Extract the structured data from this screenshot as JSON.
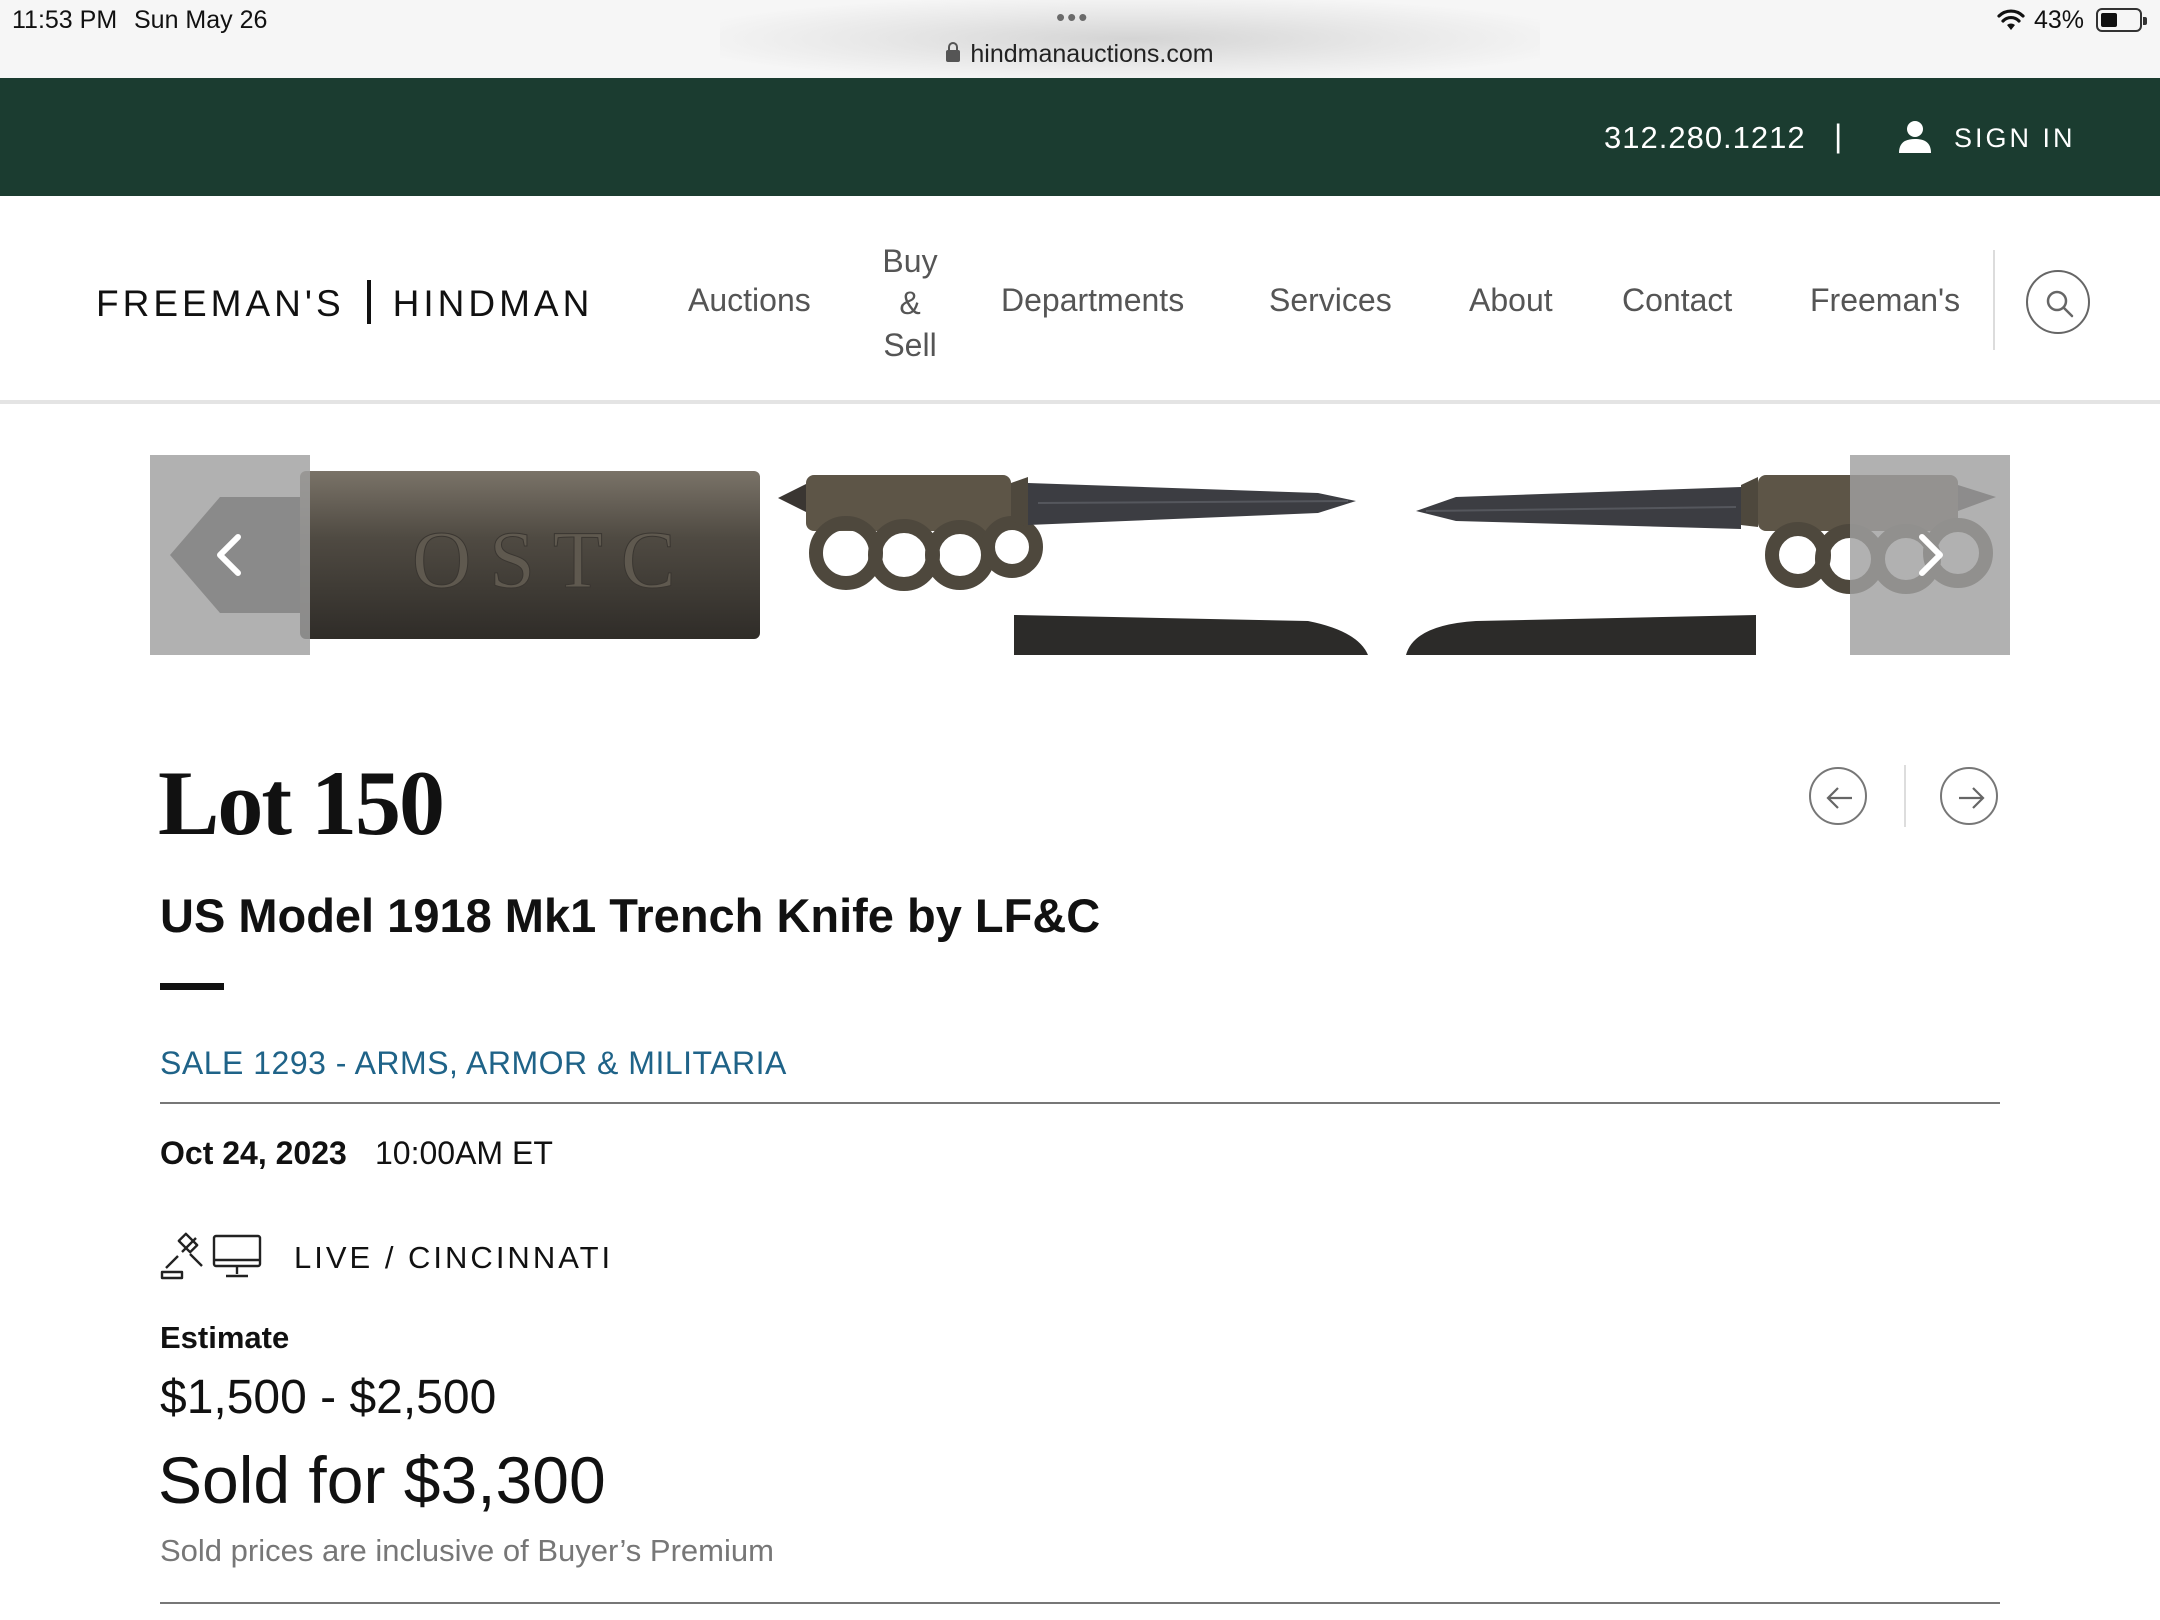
{
  "status_bar": {
    "time": "11:53 PM",
    "date": "Sun May 26",
    "url": "hindmanauctions.com",
    "battery": "43%"
  },
  "top_bar": {
    "phone": "312.280.1212",
    "separator": "|",
    "sign_in": "SIGN IN"
  },
  "header": {
    "logo_left": "FREEMAN'S",
    "logo_right": "HINDMAN",
    "nav": {
      "auctions": "Auctions",
      "buy_line1": "Buy",
      "buy_line2": "&",
      "buy_line3": "Sell",
      "departments": "Departments",
      "services": "Services",
      "about": "About",
      "contact": "Contact",
      "freemans": "Freeman's"
    }
  },
  "gallery": {
    "engraving": "OSTC"
  },
  "lot": {
    "lot_label": "Lot 150",
    "title": "US Model 1918 Mk1 Trench Knife by LF&C",
    "sale_link": "SALE 1293 - ARMS, ARMOR & MILITARIA",
    "date": "Oct 24, 2023",
    "time": "10:00AM ET",
    "live_location": "LIVE / CINCINNATI",
    "estimate_label": "Estimate",
    "estimate_range": "$1,500 - $2,500",
    "sold_text": "Sold for $3,300",
    "premium_note": "Sold prices are inclusive of Buyer’s Premium"
  },
  "colors": {
    "top_bar": "#1b3c30",
    "link": "#1f6388",
    "nav_text": "#555555"
  },
  "icons": [
    "lock-icon",
    "wifi-icon",
    "battery-icon",
    "user-icon",
    "search-icon",
    "chevron-left-icon",
    "chevron-right-icon",
    "arrow-left-icon",
    "arrow-right-icon",
    "gavel-icon",
    "monitor-icon"
  ]
}
